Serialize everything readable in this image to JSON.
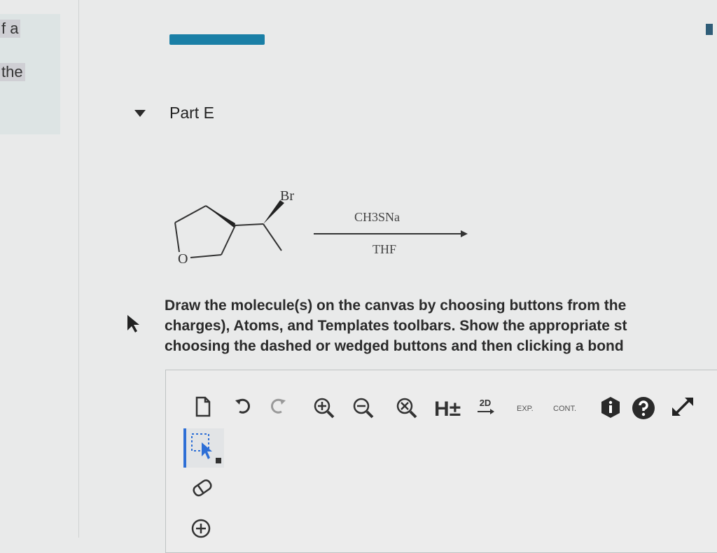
{
  "left_panel": {
    "line1": "f a",
    "line2": "the"
  },
  "part": {
    "title": "Part E"
  },
  "reaction": {
    "substituent": "Br",
    "ring_atom": "O",
    "reagent_top": "CH3SNa",
    "reagent_bottom": "THF"
  },
  "instructions": {
    "line1": "Draw the molecule(s) on the canvas by choosing buttons from the",
    "line2": "charges), Atoms, and Templates toolbars. Show the appropriate st",
    "line3": "choosing the dashed or wedged buttons and then clicking a bond"
  },
  "toolbar": {
    "h_toggle": "H±",
    "clean_2d": "2D",
    "expand": "EXP.",
    "contract": "CONT."
  },
  "colors": {
    "accent_blue": "#1a7fa6",
    "select_blue": "#2e6fd6",
    "info_dark": "#2a2a2a"
  }
}
